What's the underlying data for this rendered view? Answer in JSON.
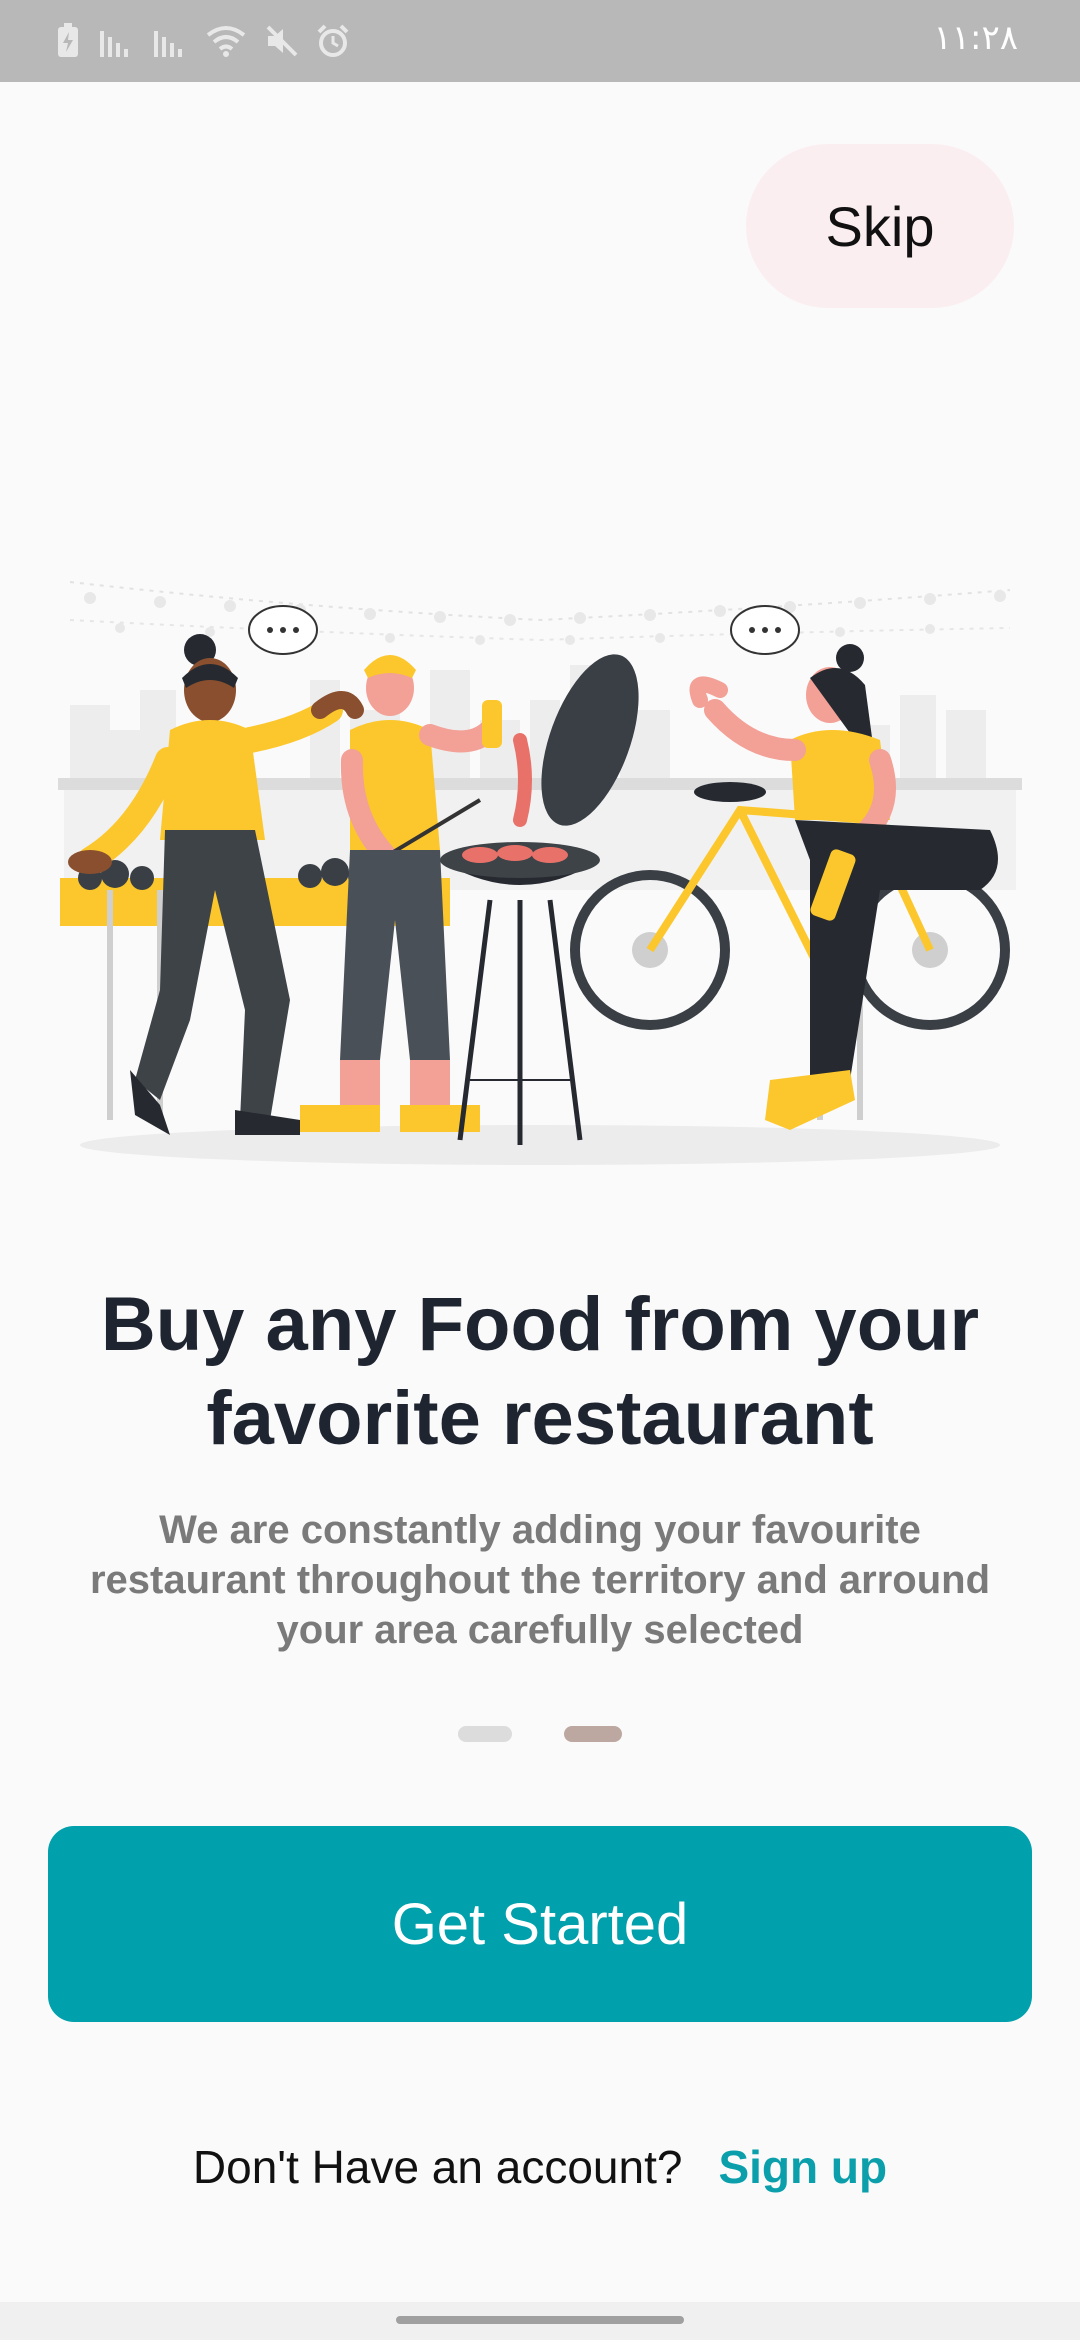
{
  "status_bar": {
    "time": "۱۱:۲۸",
    "icons": [
      "battery-charging-icon",
      "signal-icon",
      "signal-icon",
      "wifi-icon",
      "mute-icon",
      "alarm-icon"
    ]
  },
  "onboarding": {
    "skip_label": "Skip",
    "illustration": "barbecue-party-illustration",
    "headline": "Buy any Food from your favorite restaurant",
    "subtitle": "We are constantly adding your favourite restaurant throughout the territory and arround your area carefully selected",
    "page_indicator": {
      "total": 2,
      "active": 2
    },
    "cta_label": "Get Started",
    "footer_text": "Don't Have an account?",
    "signup_label": "Sign up"
  },
  "colors": {
    "primary": "#00a0ac",
    "skip_bg": "#fbeef1",
    "headline": "#1f2530",
    "subtitle": "#7a7a7a",
    "accent_yellow": "#fcc72c"
  }
}
